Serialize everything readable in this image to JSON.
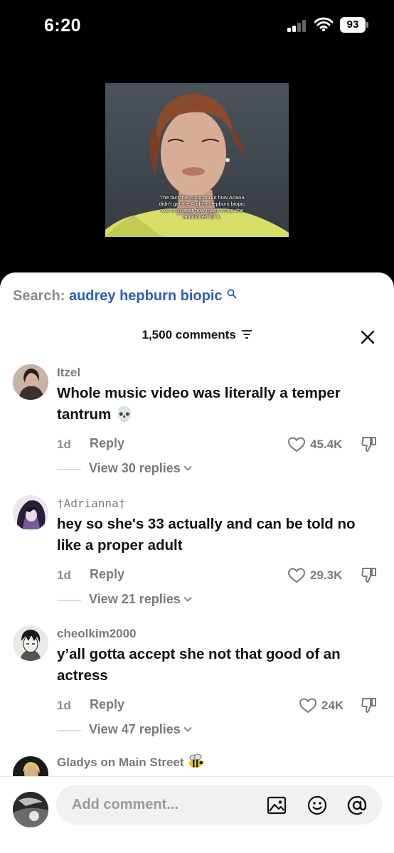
{
  "status_bar": {
    "time": "6:20",
    "battery": "93"
  },
  "video": {
    "caption": "The fact this song about how Ariana didn't get the Audrey Hepburn biopic role no matter how many times she auditioned for it."
  },
  "search": {
    "prefix": "Search:",
    "term": "audrey hepburn biopic"
  },
  "comments_header": {
    "count_label": "1,500 comments"
  },
  "comments": [
    {
      "username": "Itzel",
      "text": "Whole music video was literally a temper tantrum 💀",
      "time": "1d",
      "reply_label": "Reply",
      "likes": "45.4K",
      "view_replies": "View 30 replies"
    },
    {
      "username": "†Adrianna†",
      "text": "hey so she's 33 actually and can be told no like a proper adult",
      "time": "1d",
      "reply_label": "Reply",
      "likes": "29.3K",
      "view_replies": "View 21 replies"
    },
    {
      "username": "cheolkim2000",
      "text": "y’all gotta accept she not that good of an actress",
      "time": "1d",
      "reply_label": "Reply",
      "likes": "24K",
      "view_replies": "View 47 replies"
    },
    {
      "username": "Gladys on Main Street"
    }
  ],
  "bottom_bar": {
    "placeholder": "Add comment..."
  },
  "icons": [
    "search-icon",
    "sort-icon",
    "close-icon",
    "heart-icon",
    "dislike-icon",
    "chevron-down-icon",
    "image-icon",
    "emoji-icon",
    "mention-icon",
    "bee-emoji"
  ],
  "colors": {
    "search_term": "#2d5dbd",
    "muted": "#7a7a7a",
    "text": "#111111",
    "sheet": "#ffffff",
    "input_bg": "#f1f1f2"
  }
}
